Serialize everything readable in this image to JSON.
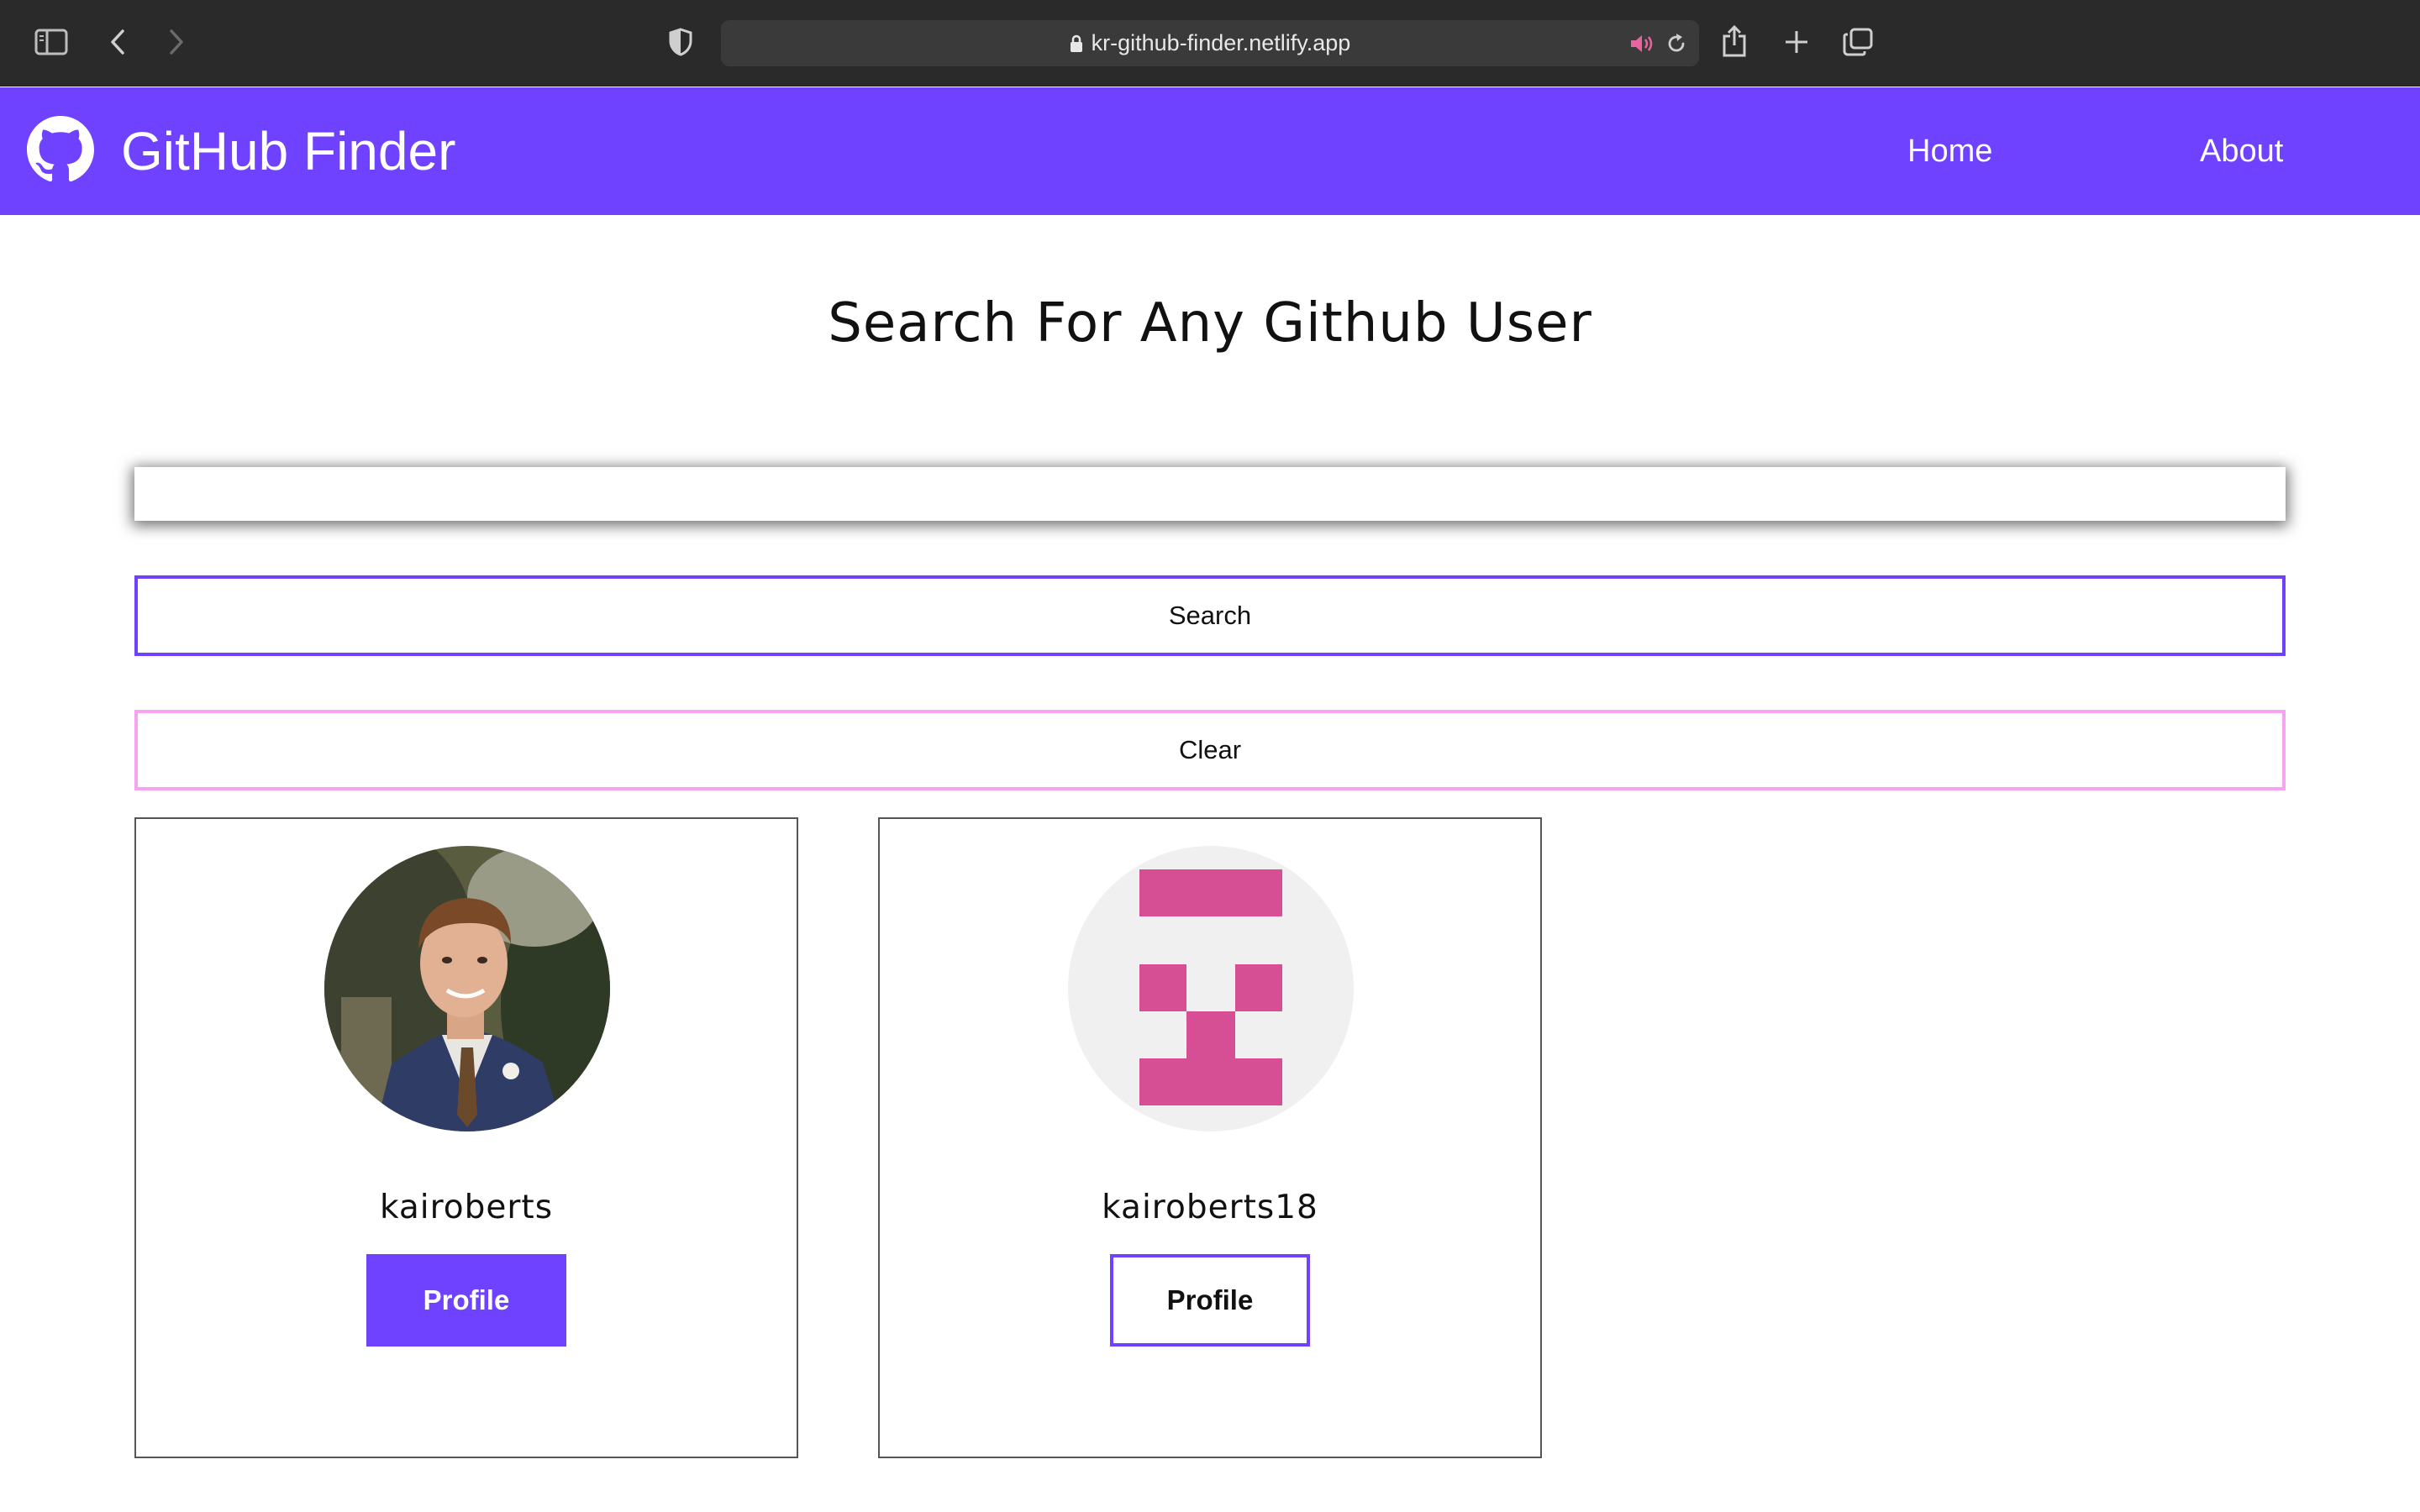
{
  "browser": {
    "url": "kr-github-finder.netlify.app",
    "icons": [
      "sidebar-icon",
      "back-icon",
      "forward-icon",
      "shield-icon",
      "lock-icon",
      "audio-icon",
      "reload-icon",
      "share-icon",
      "new-tab-icon",
      "tabs-icon"
    ]
  },
  "navbar": {
    "title": "GitHub Finder",
    "logo_icon": "github-icon",
    "links": [
      "Home",
      "About"
    ],
    "background": "#6f42ff"
  },
  "main": {
    "heading": "Search For Any Github User",
    "search": {
      "value": "",
      "placeholder": ""
    },
    "search_button": "Search",
    "clear_button": "Clear"
  },
  "users": [
    {
      "username": "kairoberts",
      "profile_label": "Profile",
      "avatar": "photo-avatar",
      "button_style": "filled"
    },
    {
      "username": "kairoberts18",
      "profile_label": "Profile",
      "avatar": "identicon-avatar",
      "button_style": "outlined"
    }
  ],
  "colors": {
    "accent": "#6f42ff",
    "clear_border": "#f7a3f1",
    "identicon": "#d64f94"
  }
}
